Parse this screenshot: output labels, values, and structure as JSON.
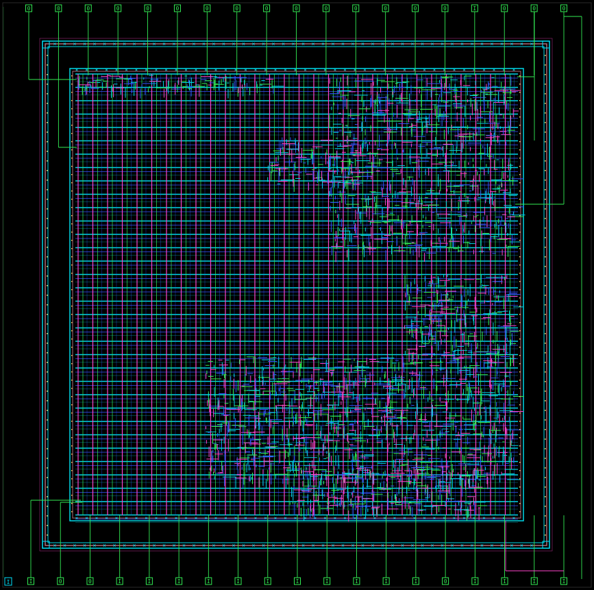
{
  "colors": {
    "background": "#000000",
    "pin": "#33ee55",
    "pin_vdd": "#00e5ff",
    "metal_h": "#00d7e8",
    "metal_h2": "#3355ff",
    "metal_v": "#ff44cc",
    "metal_v2": "#33ee55",
    "ring_outer": "#b06a7a",
    "ring_accent": "#ffe066"
  },
  "pins": {
    "top": [
      "0",
      "0",
      "0",
      "0",
      "0",
      "0",
      "0",
      "0",
      "0",
      "0",
      "0",
      "0",
      "0",
      "0",
      "0",
      "I",
      "0",
      "0",
      "0"
    ],
    "bottom": [
      "I",
      "0",
      "0",
      "I",
      "I",
      "I",
      "I",
      "I",
      "I",
      "I",
      "I",
      "I",
      "I",
      "I",
      "0",
      "I",
      "I",
      "I",
      "I"
    ]
  }
}
